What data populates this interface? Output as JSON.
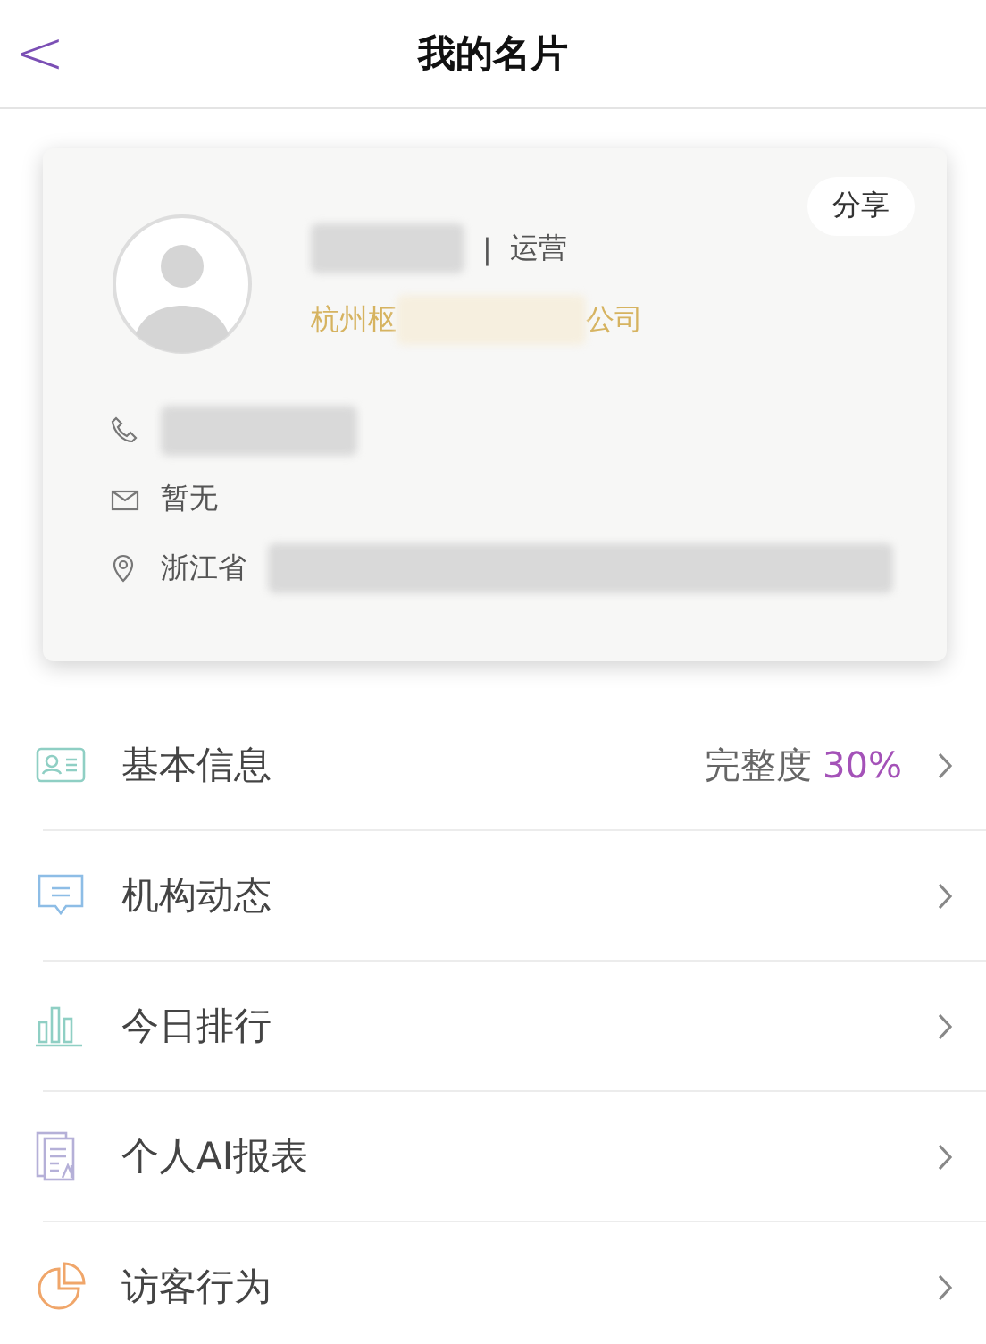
{
  "header": {
    "back": "<",
    "title": "我的名片"
  },
  "card": {
    "share": "分享",
    "role_separator": "|",
    "role": "运营",
    "company_start": "杭州枢",
    "company_end": "公司",
    "contacts": [
      {
        "kind": "phone"
      },
      {
        "kind": "mail",
        "text": "暂无"
      },
      {
        "kind": "location",
        "text": "浙江省"
      }
    ]
  },
  "menu": [
    {
      "kind": "card",
      "label": "基本信息",
      "completeness_label": "完整度",
      "completeness_value": "30%"
    },
    {
      "kind": "message",
      "label": "机构动态"
    },
    {
      "kind": "bars",
      "label": "今日排行"
    },
    {
      "kind": "report",
      "label": "个人AI报表"
    },
    {
      "kind": "pie",
      "label": "访客行为"
    }
  ]
}
